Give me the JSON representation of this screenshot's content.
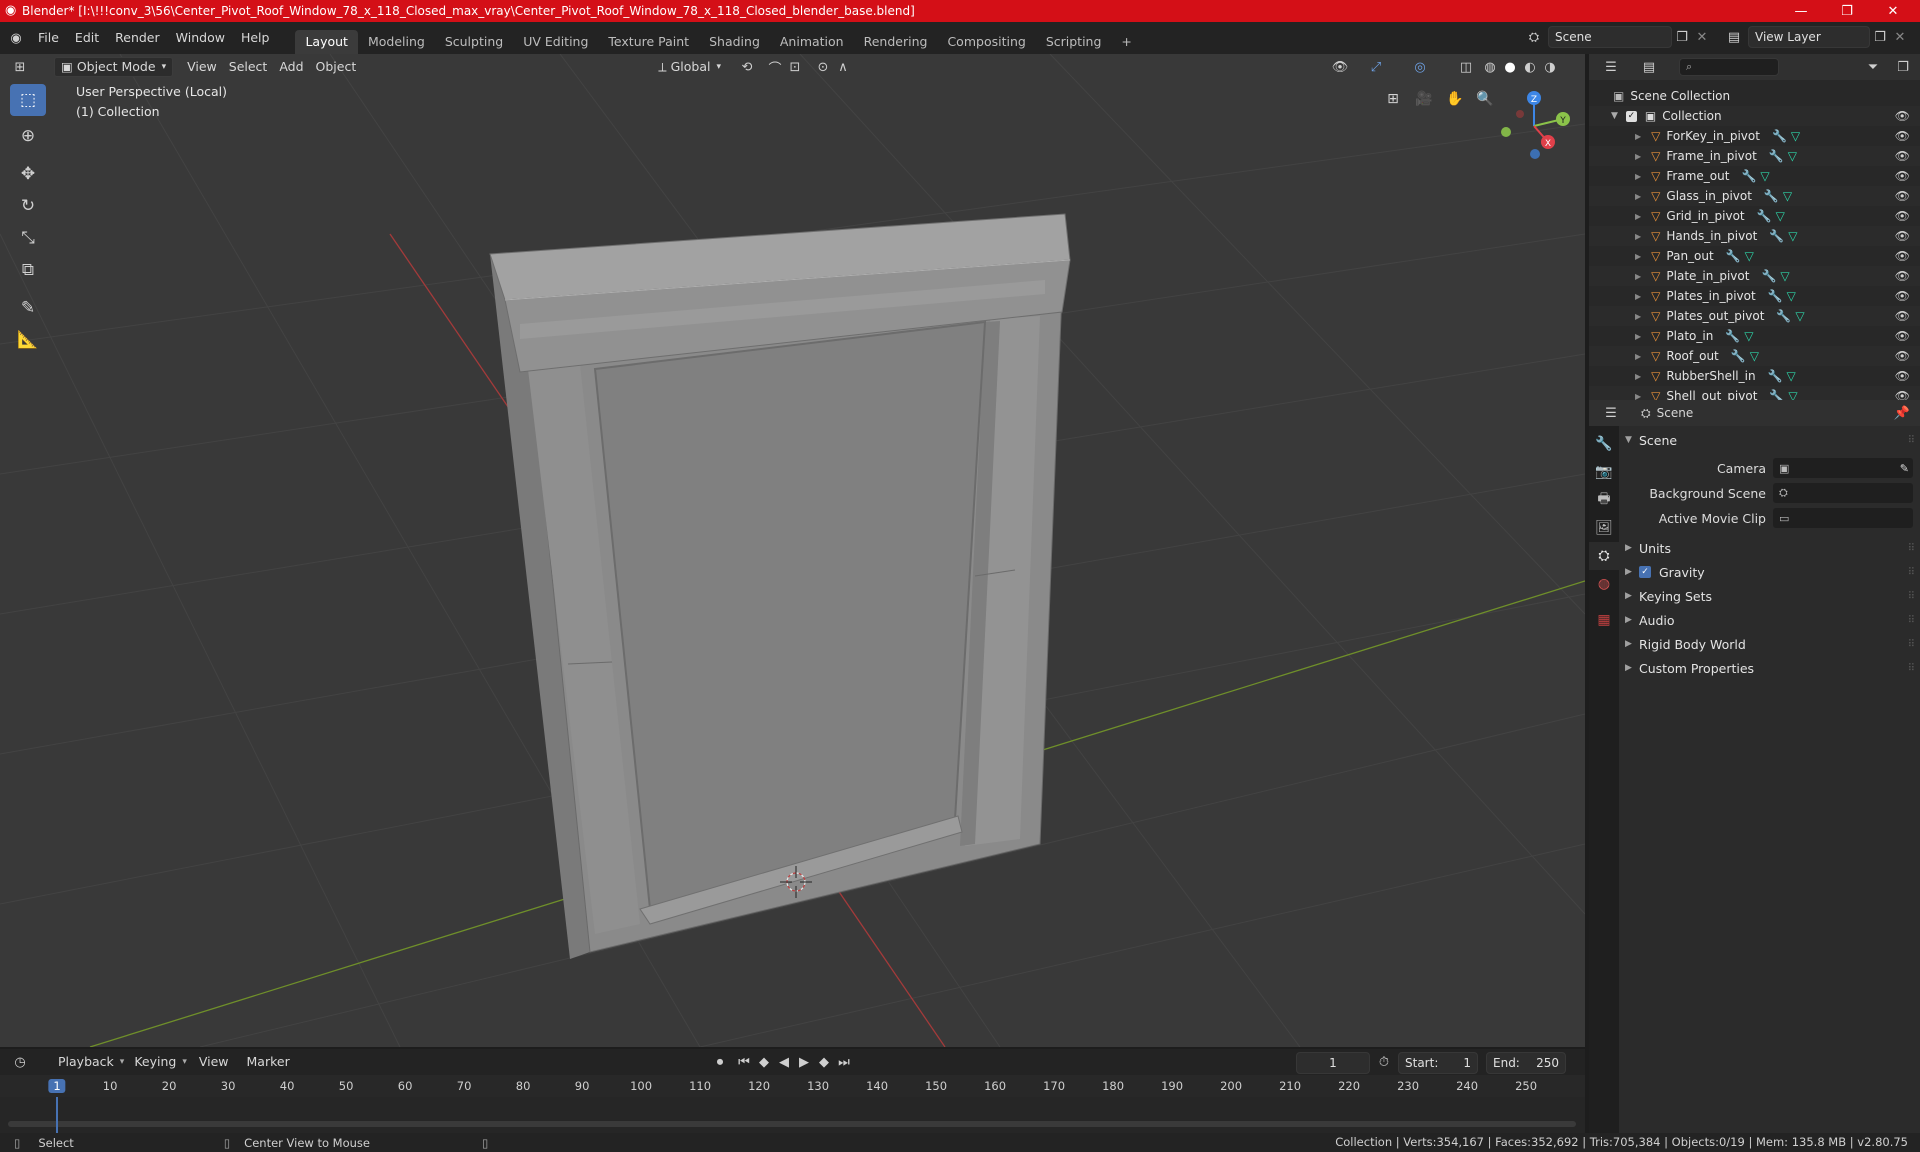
{
  "titlebar": {
    "title": "Blender* [I:\\!!!conv_3\\56\\Center_Pivot_Roof_Window_78_x_118_Closed_max_vray\\Center_Pivot_Roof_Window_78_x_118_Closed_blender_base.blend]",
    "minimize": "—",
    "maximize": "❐",
    "close": "✕"
  },
  "menu": [
    "File",
    "Edit",
    "Render",
    "Window",
    "Help"
  ],
  "workspaces": [
    "Layout",
    "Modeling",
    "Sculpting",
    "UV Editing",
    "Texture Paint",
    "Shading",
    "Animation",
    "Rendering",
    "Compositing",
    "Scripting"
  ],
  "active_workspace": "Layout",
  "add_workspace": "+",
  "scene_field": "Scene",
  "view_layer_field": "View Layer",
  "viewport": {
    "mode": "Object Mode",
    "menus": [
      "View",
      "Select",
      "Add",
      "Object"
    ],
    "transform_orientation": "Global",
    "info_line1": "User Perspective (Local)",
    "info_line2": "(1) Collection",
    "gizmo": {
      "x": "X",
      "y": "Y",
      "z": "Z"
    }
  },
  "outliner": {
    "search_placeholder": "",
    "root": "Scene Collection",
    "collection": "Collection",
    "objects": [
      "ForKey_in_pivot",
      "Frame_in_pivot",
      "Frame_out",
      "Glass_in_pivot",
      "Grid_in_pivot",
      "Hands_in_pivot",
      "Pan_out",
      "Plate_in_pivot",
      "Plates_in_pivot",
      "Plates_out_pivot",
      "Plato_in",
      "Roof_out",
      "RubberShell_in",
      "Shell_out_pivot"
    ]
  },
  "properties": {
    "header": "Scene",
    "panel_scene": "Scene",
    "camera_label": "Camera",
    "background_scene_label": "Background Scene",
    "active_movie_clip_label": "Active Movie Clip",
    "panels": [
      "Units",
      "Gravity",
      "Keying Sets",
      "Audio",
      "Rigid Body World",
      "Custom Properties"
    ],
    "gravity_checked": true
  },
  "timeline": {
    "menus": [
      "Playback",
      "Keying",
      "View",
      "Marker"
    ],
    "current_frame": "1",
    "start_label": "Start:",
    "start_value": "1",
    "end_label": "End:",
    "end_value": "250",
    "ticks": [
      "1",
      "10",
      "20",
      "30",
      "40",
      "50",
      "60",
      "70",
      "80",
      "90",
      "100",
      "110",
      "120",
      "130",
      "140",
      "150",
      "160",
      "170",
      "180",
      "190",
      "200",
      "210",
      "220",
      "230",
      "240",
      "250"
    ]
  },
  "statusbar": {
    "left_action": "Select",
    "mid_action": "Center View to Mouse",
    "stats": "Collection | Verts:354,167 | Faces:352,692 | Tris:705,384 | Objects:0/19 | Mem: 135.8 MB | v2.80.75"
  },
  "colors": {
    "titlebar": "#d40f17",
    "accent": "#4772b3",
    "object_orange": "#e8913a",
    "mesh_green": "#2ed3a7",
    "axis_x": "#e0404a",
    "axis_y": "#8bc34a",
    "axis_z": "#3d86e6"
  }
}
